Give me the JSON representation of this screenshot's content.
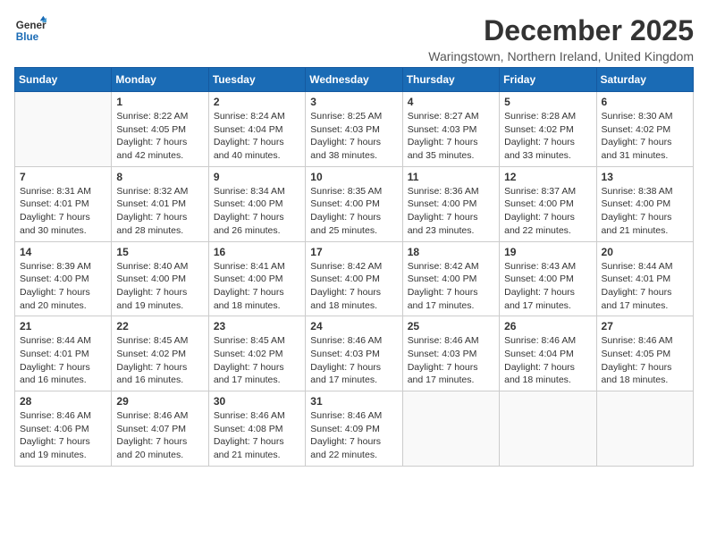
{
  "header": {
    "logo_line1": "General",
    "logo_line2": "Blue",
    "month": "December 2025",
    "location": "Waringstown, Northern Ireland, United Kingdom"
  },
  "days_of_week": [
    "Sunday",
    "Monday",
    "Tuesday",
    "Wednesday",
    "Thursday",
    "Friday",
    "Saturday"
  ],
  "weeks": [
    [
      {
        "day": "",
        "info": ""
      },
      {
        "day": "1",
        "info": "Sunrise: 8:22 AM\nSunset: 4:05 PM\nDaylight: 7 hours\nand 42 minutes."
      },
      {
        "day": "2",
        "info": "Sunrise: 8:24 AM\nSunset: 4:04 PM\nDaylight: 7 hours\nand 40 minutes."
      },
      {
        "day": "3",
        "info": "Sunrise: 8:25 AM\nSunset: 4:03 PM\nDaylight: 7 hours\nand 38 minutes."
      },
      {
        "day": "4",
        "info": "Sunrise: 8:27 AM\nSunset: 4:03 PM\nDaylight: 7 hours\nand 35 minutes."
      },
      {
        "day": "5",
        "info": "Sunrise: 8:28 AM\nSunset: 4:02 PM\nDaylight: 7 hours\nand 33 minutes."
      },
      {
        "day": "6",
        "info": "Sunrise: 8:30 AM\nSunset: 4:02 PM\nDaylight: 7 hours\nand 31 minutes."
      }
    ],
    [
      {
        "day": "7",
        "info": "Sunrise: 8:31 AM\nSunset: 4:01 PM\nDaylight: 7 hours\nand 30 minutes."
      },
      {
        "day": "8",
        "info": "Sunrise: 8:32 AM\nSunset: 4:01 PM\nDaylight: 7 hours\nand 28 minutes."
      },
      {
        "day": "9",
        "info": "Sunrise: 8:34 AM\nSunset: 4:00 PM\nDaylight: 7 hours\nand 26 minutes."
      },
      {
        "day": "10",
        "info": "Sunrise: 8:35 AM\nSunset: 4:00 PM\nDaylight: 7 hours\nand 25 minutes."
      },
      {
        "day": "11",
        "info": "Sunrise: 8:36 AM\nSunset: 4:00 PM\nDaylight: 7 hours\nand 23 minutes."
      },
      {
        "day": "12",
        "info": "Sunrise: 8:37 AM\nSunset: 4:00 PM\nDaylight: 7 hours\nand 22 minutes."
      },
      {
        "day": "13",
        "info": "Sunrise: 8:38 AM\nSunset: 4:00 PM\nDaylight: 7 hours\nand 21 minutes."
      }
    ],
    [
      {
        "day": "14",
        "info": "Sunrise: 8:39 AM\nSunset: 4:00 PM\nDaylight: 7 hours\nand 20 minutes."
      },
      {
        "day": "15",
        "info": "Sunrise: 8:40 AM\nSunset: 4:00 PM\nDaylight: 7 hours\nand 19 minutes."
      },
      {
        "day": "16",
        "info": "Sunrise: 8:41 AM\nSunset: 4:00 PM\nDaylight: 7 hours\nand 18 minutes."
      },
      {
        "day": "17",
        "info": "Sunrise: 8:42 AM\nSunset: 4:00 PM\nDaylight: 7 hours\nand 18 minutes."
      },
      {
        "day": "18",
        "info": "Sunrise: 8:42 AM\nSunset: 4:00 PM\nDaylight: 7 hours\nand 17 minutes."
      },
      {
        "day": "19",
        "info": "Sunrise: 8:43 AM\nSunset: 4:00 PM\nDaylight: 7 hours\nand 17 minutes."
      },
      {
        "day": "20",
        "info": "Sunrise: 8:44 AM\nSunset: 4:01 PM\nDaylight: 7 hours\nand 17 minutes."
      }
    ],
    [
      {
        "day": "21",
        "info": "Sunrise: 8:44 AM\nSunset: 4:01 PM\nDaylight: 7 hours\nand 16 minutes."
      },
      {
        "day": "22",
        "info": "Sunrise: 8:45 AM\nSunset: 4:02 PM\nDaylight: 7 hours\nand 16 minutes."
      },
      {
        "day": "23",
        "info": "Sunrise: 8:45 AM\nSunset: 4:02 PM\nDaylight: 7 hours\nand 17 minutes."
      },
      {
        "day": "24",
        "info": "Sunrise: 8:46 AM\nSunset: 4:03 PM\nDaylight: 7 hours\nand 17 minutes."
      },
      {
        "day": "25",
        "info": "Sunrise: 8:46 AM\nSunset: 4:03 PM\nDaylight: 7 hours\nand 17 minutes."
      },
      {
        "day": "26",
        "info": "Sunrise: 8:46 AM\nSunset: 4:04 PM\nDaylight: 7 hours\nand 18 minutes."
      },
      {
        "day": "27",
        "info": "Sunrise: 8:46 AM\nSunset: 4:05 PM\nDaylight: 7 hours\nand 18 minutes."
      }
    ],
    [
      {
        "day": "28",
        "info": "Sunrise: 8:46 AM\nSunset: 4:06 PM\nDaylight: 7 hours\nand 19 minutes."
      },
      {
        "day": "29",
        "info": "Sunrise: 8:46 AM\nSunset: 4:07 PM\nDaylight: 7 hours\nand 20 minutes."
      },
      {
        "day": "30",
        "info": "Sunrise: 8:46 AM\nSunset: 4:08 PM\nDaylight: 7 hours\nand 21 minutes."
      },
      {
        "day": "31",
        "info": "Sunrise: 8:46 AM\nSunset: 4:09 PM\nDaylight: 7 hours\nand 22 minutes."
      },
      {
        "day": "",
        "info": ""
      },
      {
        "day": "",
        "info": ""
      },
      {
        "day": "",
        "info": ""
      }
    ]
  ]
}
